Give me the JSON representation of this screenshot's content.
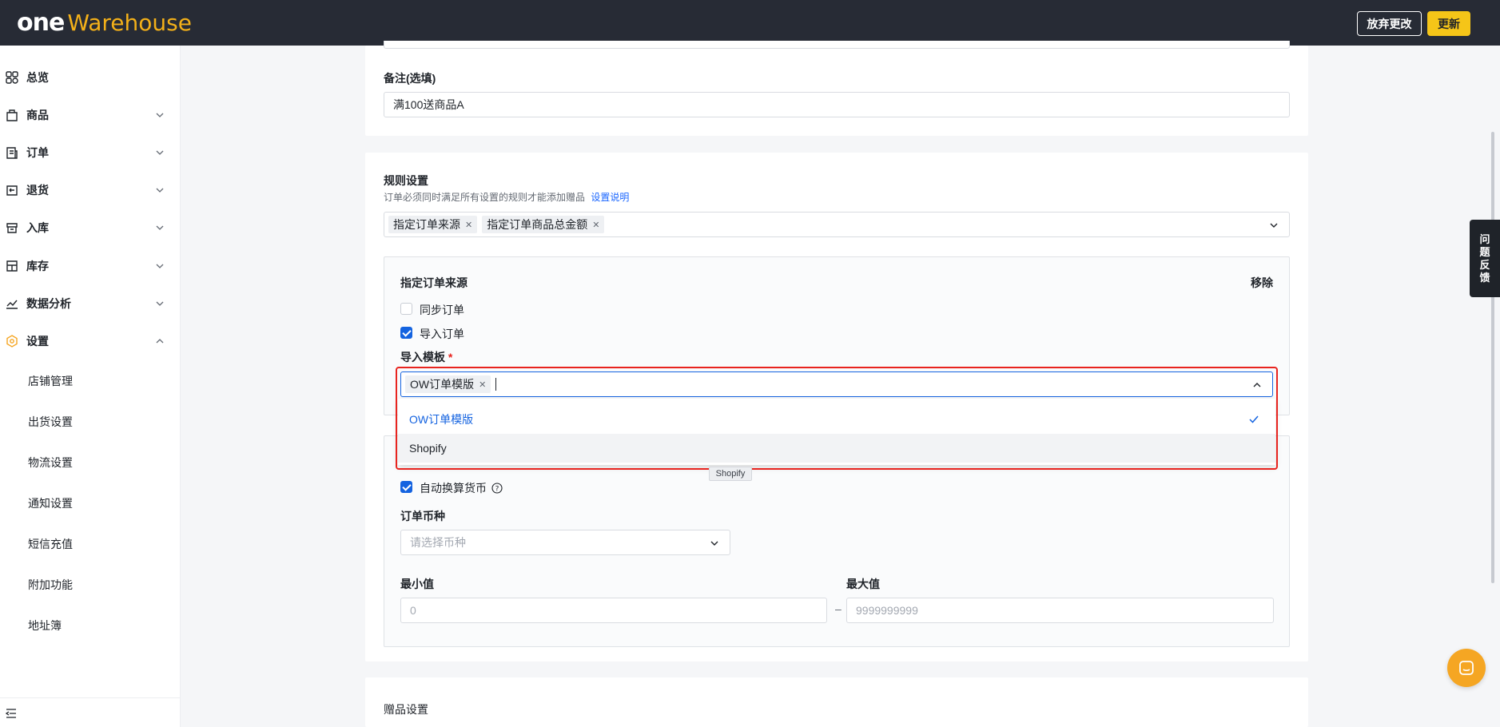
{
  "header": {
    "logo_one": "one",
    "logo_warehouse": "Warehouse",
    "discard_label": "放弃更改",
    "update_label": "更新"
  },
  "sidebar": {
    "items": [
      {
        "label": "总览",
        "icon": "overview-icon"
      },
      {
        "label": "商品",
        "icon": "product-icon"
      },
      {
        "label": "订单",
        "icon": "order-icon"
      },
      {
        "label": "退货",
        "icon": "return-icon"
      },
      {
        "label": "入库",
        "icon": "inbound-icon"
      },
      {
        "label": "库存",
        "icon": "inventory-icon"
      },
      {
        "label": "数据分析",
        "icon": "analytics-icon"
      },
      {
        "label": "设置",
        "icon": "settings-icon"
      }
    ],
    "sub_items": [
      "店铺管理",
      "出货设置",
      "物流设置",
      "通知设置",
      "短信充值",
      "附加功能",
      "地址簿"
    ]
  },
  "remark": {
    "label": "备注(选填)",
    "value": "满100送商品A"
  },
  "rules": {
    "title": "规则设置",
    "desc": "订单必须同时满足所有设置的规则才能添加赠品",
    "desc_link": "设置说明",
    "tags": [
      "指定订单来源",
      "指定订单商品总金额"
    ]
  },
  "source": {
    "title": "指定订单来源",
    "remove": "移除",
    "sync_label": "同步订单",
    "sync_checked": false,
    "import_label": "导入订单",
    "import_checked": true,
    "template_label": "导入模板",
    "template_tag": "OW订单模版",
    "options": [
      "OW订单模版",
      "Shopify"
    ],
    "tooltip": "Shopify"
  },
  "amount": {
    "auto_convert_label": "自动换算货币",
    "auto_convert_checked": true,
    "currency_label": "订单币种",
    "currency_placeholder": "请选择币种",
    "min_label": "最小值",
    "min_placeholder": "0",
    "max_label": "最大值",
    "max_placeholder": "9999999999",
    "range_sep": "–"
  },
  "gift": {
    "title": "赠品设置"
  },
  "feedback": {
    "chars": [
      "问",
      "题",
      "反",
      "馈"
    ]
  },
  "colors": {
    "topbar": "#272b35",
    "brand_yellow": "#f5c518",
    "accent_blue": "#1463e0",
    "highlight_red": "#e8241f"
  }
}
